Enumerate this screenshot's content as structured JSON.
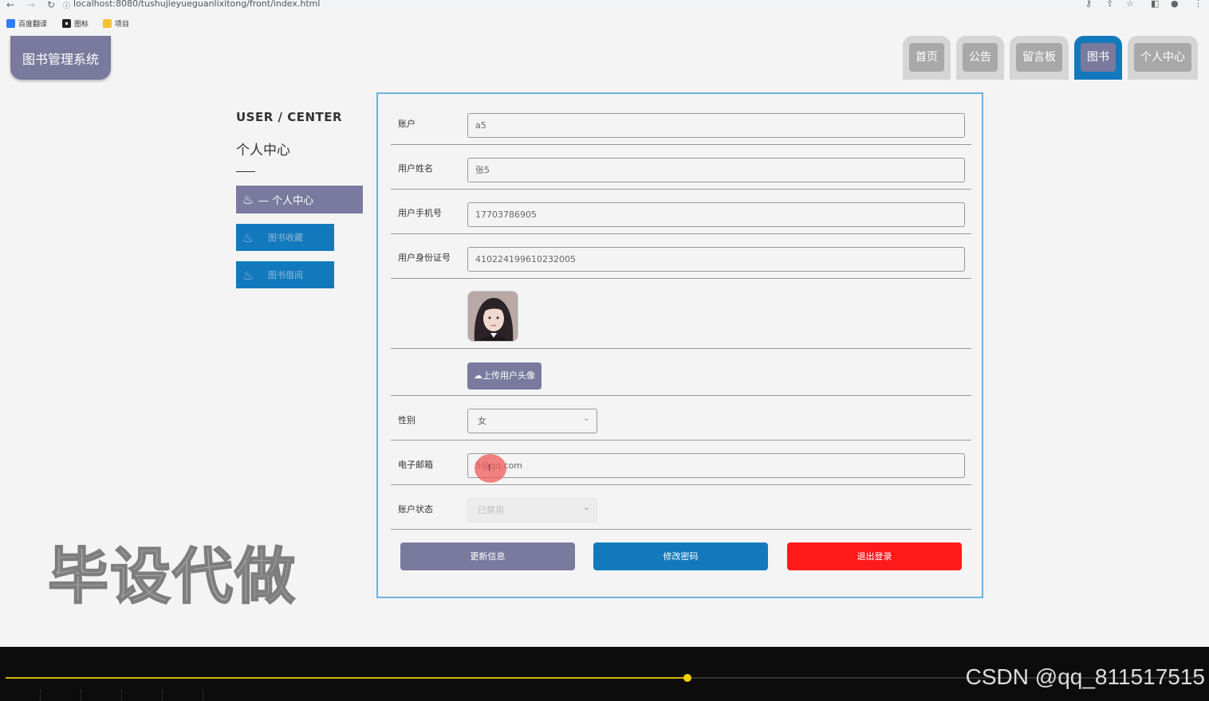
{
  "browser": {
    "url": "localhost:8080/tushujieyueguanlixitong/front/index.html",
    "bookmarks": [
      {
        "label": "百度翻译",
        "color": "#2f7df6"
      },
      {
        "label": "图标",
        "color": "#222222"
      },
      {
        "label": "项目",
        "color": "#f2c230"
      }
    ]
  },
  "header": {
    "logo": "图书管理系统",
    "nav": [
      {
        "label": "首页",
        "active": false
      },
      {
        "label": "公告",
        "active": false
      },
      {
        "label": "留言板",
        "active": false
      },
      {
        "label": "图书",
        "active": true
      },
      {
        "label": "个人中心",
        "active": false
      }
    ]
  },
  "sidebar": {
    "title_en": "USER / CENTER",
    "title_cn": "个人中心",
    "items": [
      {
        "label": "— 个人中心",
        "icon": "flame-icon"
      },
      {
        "label": "图书收藏",
        "icon": "flame-icon"
      },
      {
        "label": "图书借阅",
        "icon": "flame-icon"
      }
    ]
  },
  "form": {
    "account_label": "账户",
    "account_value": "a5",
    "name_label": "用户姓名",
    "name_value": "张5",
    "phone_label": "用户手机号",
    "phone_value": "17703786905",
    "idcard_label": "用户身份证号",
    "idcard_value": "410224199610232005",
    "upload_label": "上传用户头像",
    "gender_label": "性别",
    "gender_value": "女",
    "email_label": "电子邮箱",
    "email_value": "5@qq.com",
    "status_label": "账户状态",
    "status_value": "已禁用",
    "update_button": "更新信息",
    "password_button": "修改密码",
    "logout_button": "退出登录"
  },
  "overlay": {
    "watermark": "毕设代做",
    "csdn": "CSDN @qq_811517515",
    "video_progress": 0.57
  },
  "colors": {
    "accent": "#7a7a9e",
    "blue": "#1279bd",
    "danger": "#ff1a1a",
    "border": "#6fb2dc"
  }
}
